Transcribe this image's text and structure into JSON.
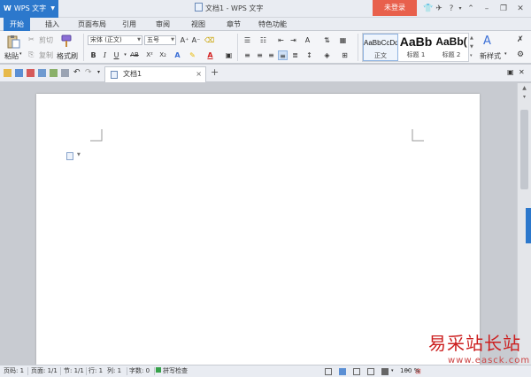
{
  "app": {
    "menu_label": "WPS 文字",
    "menu_logo": "W",
    "document_title": "文档1 - WPS 文字",
    "login_label": "未登录"
  },
  "tabs": [
    {
      "label": "开始",
      "active": true
    },
    {
      "label": "插入",
      "active": false
    },
    {
      "label": "页面布局",
      "active": false
    },
    {
      "label": "引用",
      "active": false
    },
    {
      "label": "审阅",
      "active": false
    },
    {
      "label": "视图",
      "active": false
    },
    {
      "label": "章节",
      "active": false
    },
    {
      "label": "特色功能",
      "active": false
    }
  ],
  "ribbon": {
    "paste_label": "粘贴",
    "cut_label": "剪切",
    "copy_label": "复制",
    "format_painter_label": "格式刷",
    "font_family": "宋体 (正文)",
    "font_size": "五号",
    "bold": "B",
    "italic": "I",
    "underline": "U",
    "strike": "AB",
    "superscript": "X²",
    "subscript": "X₂",
    "new_style_label": "新样式",
    "styles": [
      {
        "preview": "AaBbCcDd",
        "label": "正文",
        "selected": true
      },
      {
        "preview": "AaBb",
        "label": "标题 1",
        "selected": false
      },
      {
        "preview": "AaBb(",
        "label": "标题 2",
        "selected": false
      }
    ]
  },
  "document_tab": {
    "name": "文档1",
    "close": "×",
    "new_tab": "+"
  },
  "statusbar": {
    "page_number": "页码: 1",
    "pages": "页面: 1/1",
    "section": "节: 1/1",
    "row": "行: 1",
    "column": "列: 1",
    "word_count": "字数: 0",
    "spell_check": "拼写检查",
    "zoom": "100 %"
  },
  "watermark": {
    "site_name": "易采站长站",
    "site_url": "www.easck.com"
  },
  "colors": {
    "accent": "#2c78cc",
    "login": "#e8604c",
    "watermark": "#cc1f1f"
  }
}
